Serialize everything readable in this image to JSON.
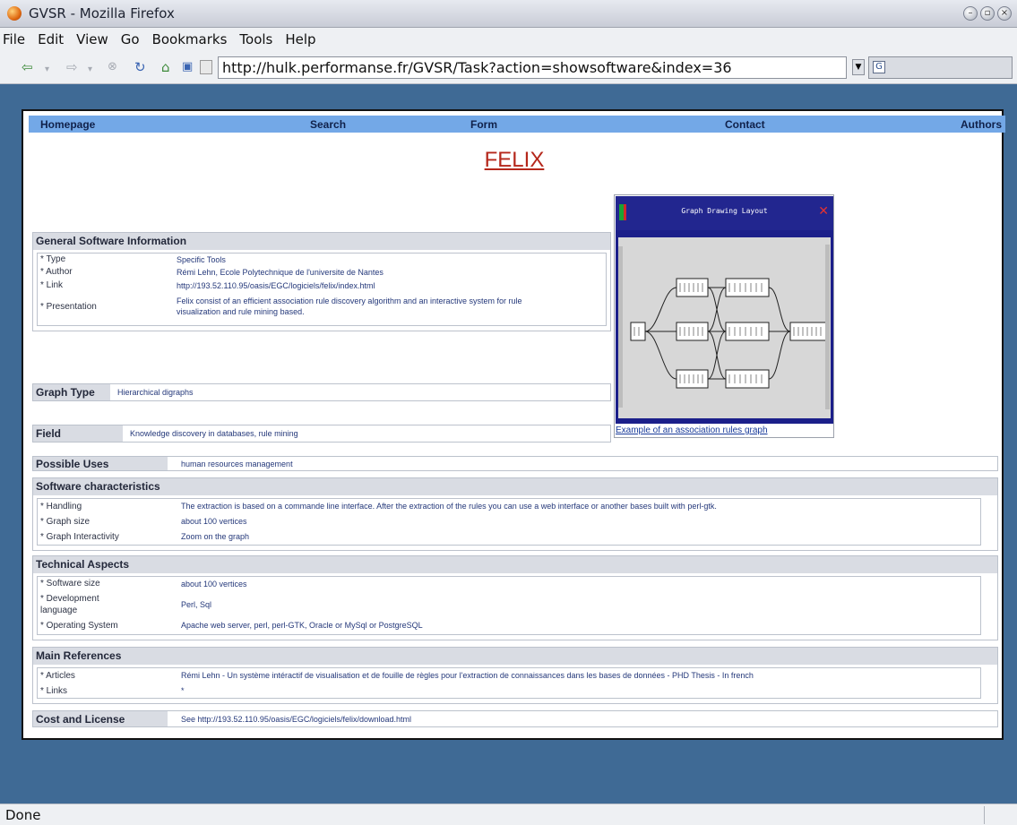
{
  "window": {
    "title": "GVSR - Mozilla Firefox"
  },
  "menu": [
    "File",
    "Edit",
    "View",
    "Go",
    "Bookmarks",
    "Tools",
    "Help"
  ],
  "toolbar": {
    "url": "http://hulk.performanse.fr/GVSR/Task?action=showsoftware&index=36"
  },
  "topnav": [
    "Homepage",
    "Search",
    "Form",
    "Contact",
    "Authors"
  ],
  "title": "FELIX",
  "general": {
    "heading": "General Software Information",
    "rows": [
      {
        "k": "* Type",
        "v": "Specific Tools"
      },
      {
        "k": "* Author",
        "v": "Rémi Lehn, Ecole Polytechnique de l'universite de Nantes"
      },
      {
        "k": "* Link",
        "v": "http://193.52.110.95/oasis/EGC/logiciels/felix/index.html"
      },
      {
        "k": "* Presentation",
        "v": "Felix consist of an efficient association rule discovery algorithm and an interactive system for rule visualization and rule mining based."
      }
    ]
  },
  "graph_type": {
    "label": "Graph Type",
    "value": "Hierarchical digraphs"
  },
  "field": {
    "label": "Field",
    "value": "Knowledge discovery in databases, rule mining"
  },
  "figure": {
    "caption": "Example of an association rules graph",
    "window_title": "Graph Drawing Layout"
  },
  "possible_uses": {
    "label": "Possible Uses",
    "value": "human resources management"
  },
  "software": {
    "heading": "Software characteristics",
    "rows": [
      {
        "k": "* Handling",
        "v": "The extraction is based on a commande line interface. After the extraction of the rules you can use a web interface or another bases built with perl-gtk."
      },
      {
        "k": "* Graph size",
        "v": "about 100 vertices"
      },
      {
        "k": "* Graph Interactivity",
        "v": "Zoom on the graph"
      }
    ]
  },
  "technical": {
    "heading": "Technical Aspects",
    "rows": [
      {
        "k": "* Software size",
        "v": "about 100 vertices"
      },
      {
        "k": "* Development language",
        "v": "Perl, Sql"
      },
      {
        "k": "* Operating System",
        "v": "Apache web server, perl, perl-GTK, Oracle or MySql or PostgreSQL"
      }
    ]
  },
  "references": {
    "heading": "Main References",
    "rows": [
      {
        "k": "* Articles",
        "v": "Rémi Lehn - Un système intéractif de visualisation et de fouille de règles pour l'extraction de connaissances dans les bases de données - PHD Thesis - In french"
      },
      {
        "k": "* Links",
        "v": "*"
      }
    ]
  },
  "license": {
    "label": "Cost and License",
    "value": "See http://193.52.110.95/oasis/EGC/logiciels/felix/download.html"
  },
  "status": "Done"
}
